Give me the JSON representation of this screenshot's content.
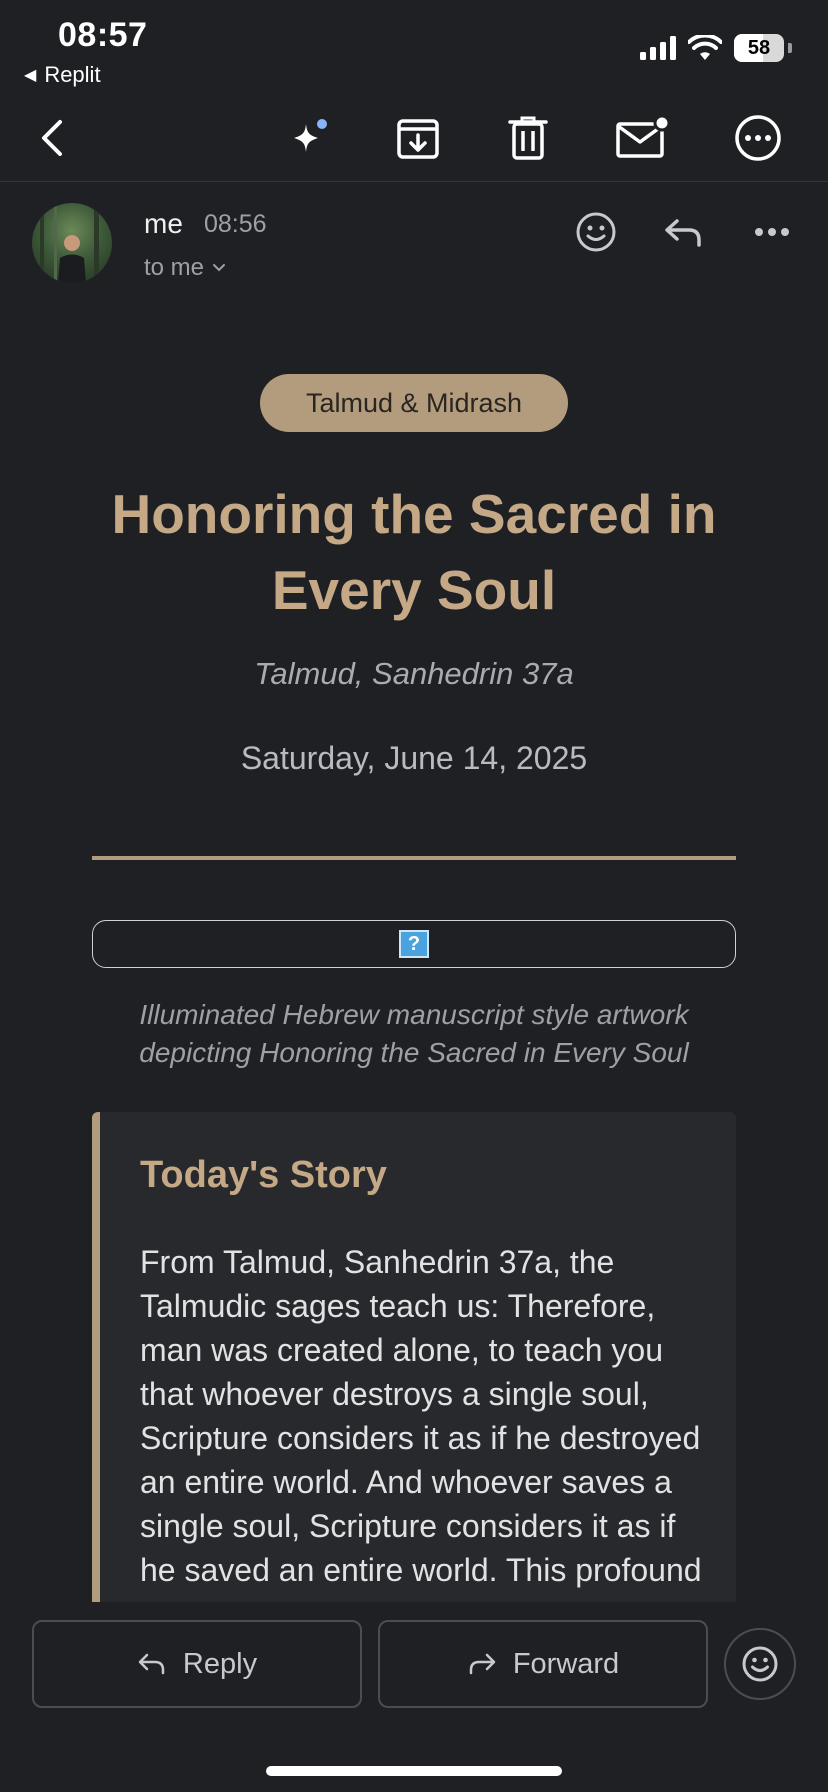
{
  "status_bar": {
    "time": "08:57",
    "back_app": "Replit",
    "battery_level": "58",
    "battery_fraction": 0.58
  },
  "toolbar": {
    "icons": [
      "back-icon",
      "sparkle-icon",
      "archive-icon",
      "trash-icon",
      "mark-unread-icon",
      "more-icon"
    ],
    "accent": "#8ab4f8"
  },
  "message": {
    "sender": "me",
    "time": "08:56",
    "recipient": "to me"
  },
  "email": {
    "category": "Talmud & Midrash",
    "title": "Honoring the Sacred in Every Soul",
    "source": "Talmud, Sanhedrin 37a",
    "date": "Saturday, June 14, 2025",
    "image_placeholder": "?",
    "caption": "Illuminated Hebrew manuscript style artwork depicting Honoring the Sacred in Every Soul",
    "story_heading": "Today's Story",
    "story_text": "From Talmud, Sanhedrin 37a, the Talmudic sages teach us: Therefore, man was created alone, to teach you that whoever destroys a single soul, Scripture considers it as if he destroyed an entire world. And whoever saves a single soul, Scripture considers it as if he saved an entire world. This profound"
  },
  "actions": {
    "reply_label": "Reply",
    "forward_label": "Forward"
  },
  "colors": {
    "background": "#1f2023",
    "accent_gold": "#c5a987",
    "pill": "#b39c7d"
  }
}
